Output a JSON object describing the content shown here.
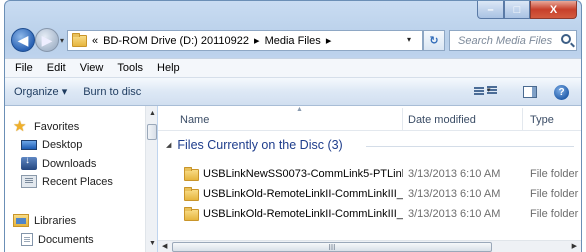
{
  "window": {
    "minimize_glyph": "–",
    "maximize_glyph": "□",
    "close_glyph": "X"
  },
  "nav": {
    "back_glyph": "◀",
    "forward_glyph": "▶",
    "dropdown_glyph": "▾"
  },
  "address": {
    "overflow": "«",
    "segments": [
      "BD-ROM Drive (D:) 20110922",
      "Media Files"
    ],
    "separator": "▸",
    "dropdown_glyph": "▾",
    "refresh_glyph": "↻"
  },
  "search": {
    "placeholder": "Search Media Files"
  },
  "menu": [
    "File",
    "Edit",
    "View",
    "Tools",
    "Help"
  ],
  "commands": {
    "organize": "Organize ▾",
    "burn": "Burn to disc"
  },
  "sidebar": {
    "favorites": "Favorites",
    "items": [
      "Desktop",
      "Downloads",
      "Recent Places"
    ],
    "libraries": "Libraries",
    "library_items": [
      "Documents"
    ]
  },
  "columns": {
    "name": "Name",
    "date": "Date modified",
    "type": "Type"
  },
  "group": {
    "title": "Files Currently on the Disc (3)"
  },
  "files": [
    {
      "name": "USBLinkNewSS0073-CommLink5-PTLinkI...",
      "date": "3/13/2013 6:10 AM",
      "type": "File folder"
    },
    {
      "name": "USBLinkOld-RemoteLinkII-CommLinkIII_I...",
      "date": "3/13/2013 6:10 AM",
      "type": "File folder"
    },
    {
      "name": "USBLinkOld-RemoteLinkII-CommLinkIII_I...",
      "date": "3/13/2013 6:10 AM",
      "type": "File folder"
    }
  ],
  "scroll": {
    "grip": "III"
  },
  "colors": {
    "group_title": "#1e3d8c",
    "close_button": "#c7402b",
    "accent": "#2a62b4"
  }
}
